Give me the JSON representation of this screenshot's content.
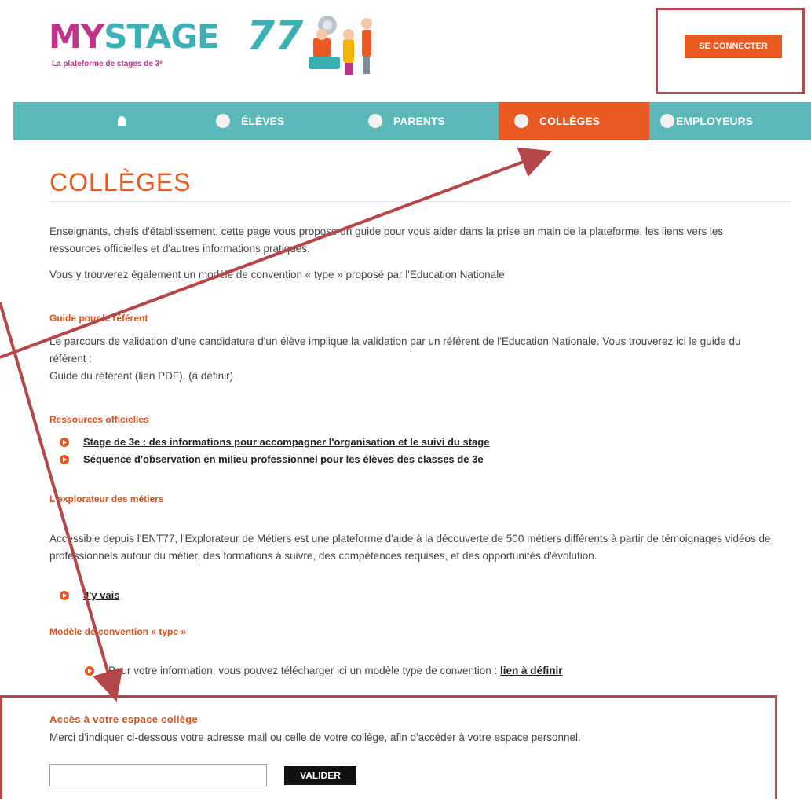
{
  "header": {
    "logo_my": "MY",
    "logo_stage": "STAGE",
    "logo_77": "77",
    "logo_tagline": "La plateforme de stages de 3ᵉ",
    "login_label": "SE CONNECTER"
  },
  "nav": {
    "items": [
      {
        "label": "",
        "icon": "home-icon"
      },
      {
        "label": "ÉLÈVES"
      },
      {
        "label": "PARENTS"
      },
      {
        "label": "COLLÈGES",
        "active": true
      },
      {
        "label": "EMPLOYEURS"
      }
    ]
  },
  "page": {
    "title": "COLLÈGES",
    "intro_1": "Enseignants, chefs d'établissement, cette page vous propose un guide pour vous aider dans la prise en main de la plateforme, les liens vers les ressources officielles et d'autres informations pratiques.",
    "intro_2": "Vous y trouverez également un modèle de convention « type » proposé par l'Education Nationale",
    "guide_heading": "Guide pour le référent",
    "guide_text": "Le parcours de validation d'une candidature d'un élève implique la validation par un référent de l'Education Nationale. Vous trouverez ici le guide du référent :",
    "guide_link": "Guide du référent (lien PDF). (à définir)",
    "ressources_heading": "Ressources officielles",
    "ressources_links": [
      "Stage de 3e : des informations pour accompagner l'organisation et le suivi du stage",
      "Séquence d'observation en milieu professionnel pour les élèves des classes de 3e"
    ],
    "explorateur_heading": "L'explorateur des métiers",
    "explorateur_text": "Accessible depuis l'ENT77, l'Explorateur de Métiers est une plateforme d'aide à la découverte de 500 métiers différents à partir de témoignages vidéos de professionnels autour du métier, des formations à suivre, des compétences requises, et des opportunités d'évolution.",
    "explorateur_link": "J'y vais",
    "modele_heading": "Modèle de convention « type »",
    "modele_text": "Pour votre information, vous pouvez télécharger ici un modèle type de convention : ",
    "modele_link": "lien à définir",
    "access_heading": "Accès à votre espace collège",
    "access_text": "Merci d'indiquer ci-dessous votre adresse mail ou celle de votre collège, afin d'accéder à votre espace personnel.",
    "email_value": "",
    "valider_label": "VALIDER"
  },
  "colors": {
    "teal": "#5ab8b8",
    "orange": "#e85a21",
    "annotation_red": "#b5474b"
  }
}
